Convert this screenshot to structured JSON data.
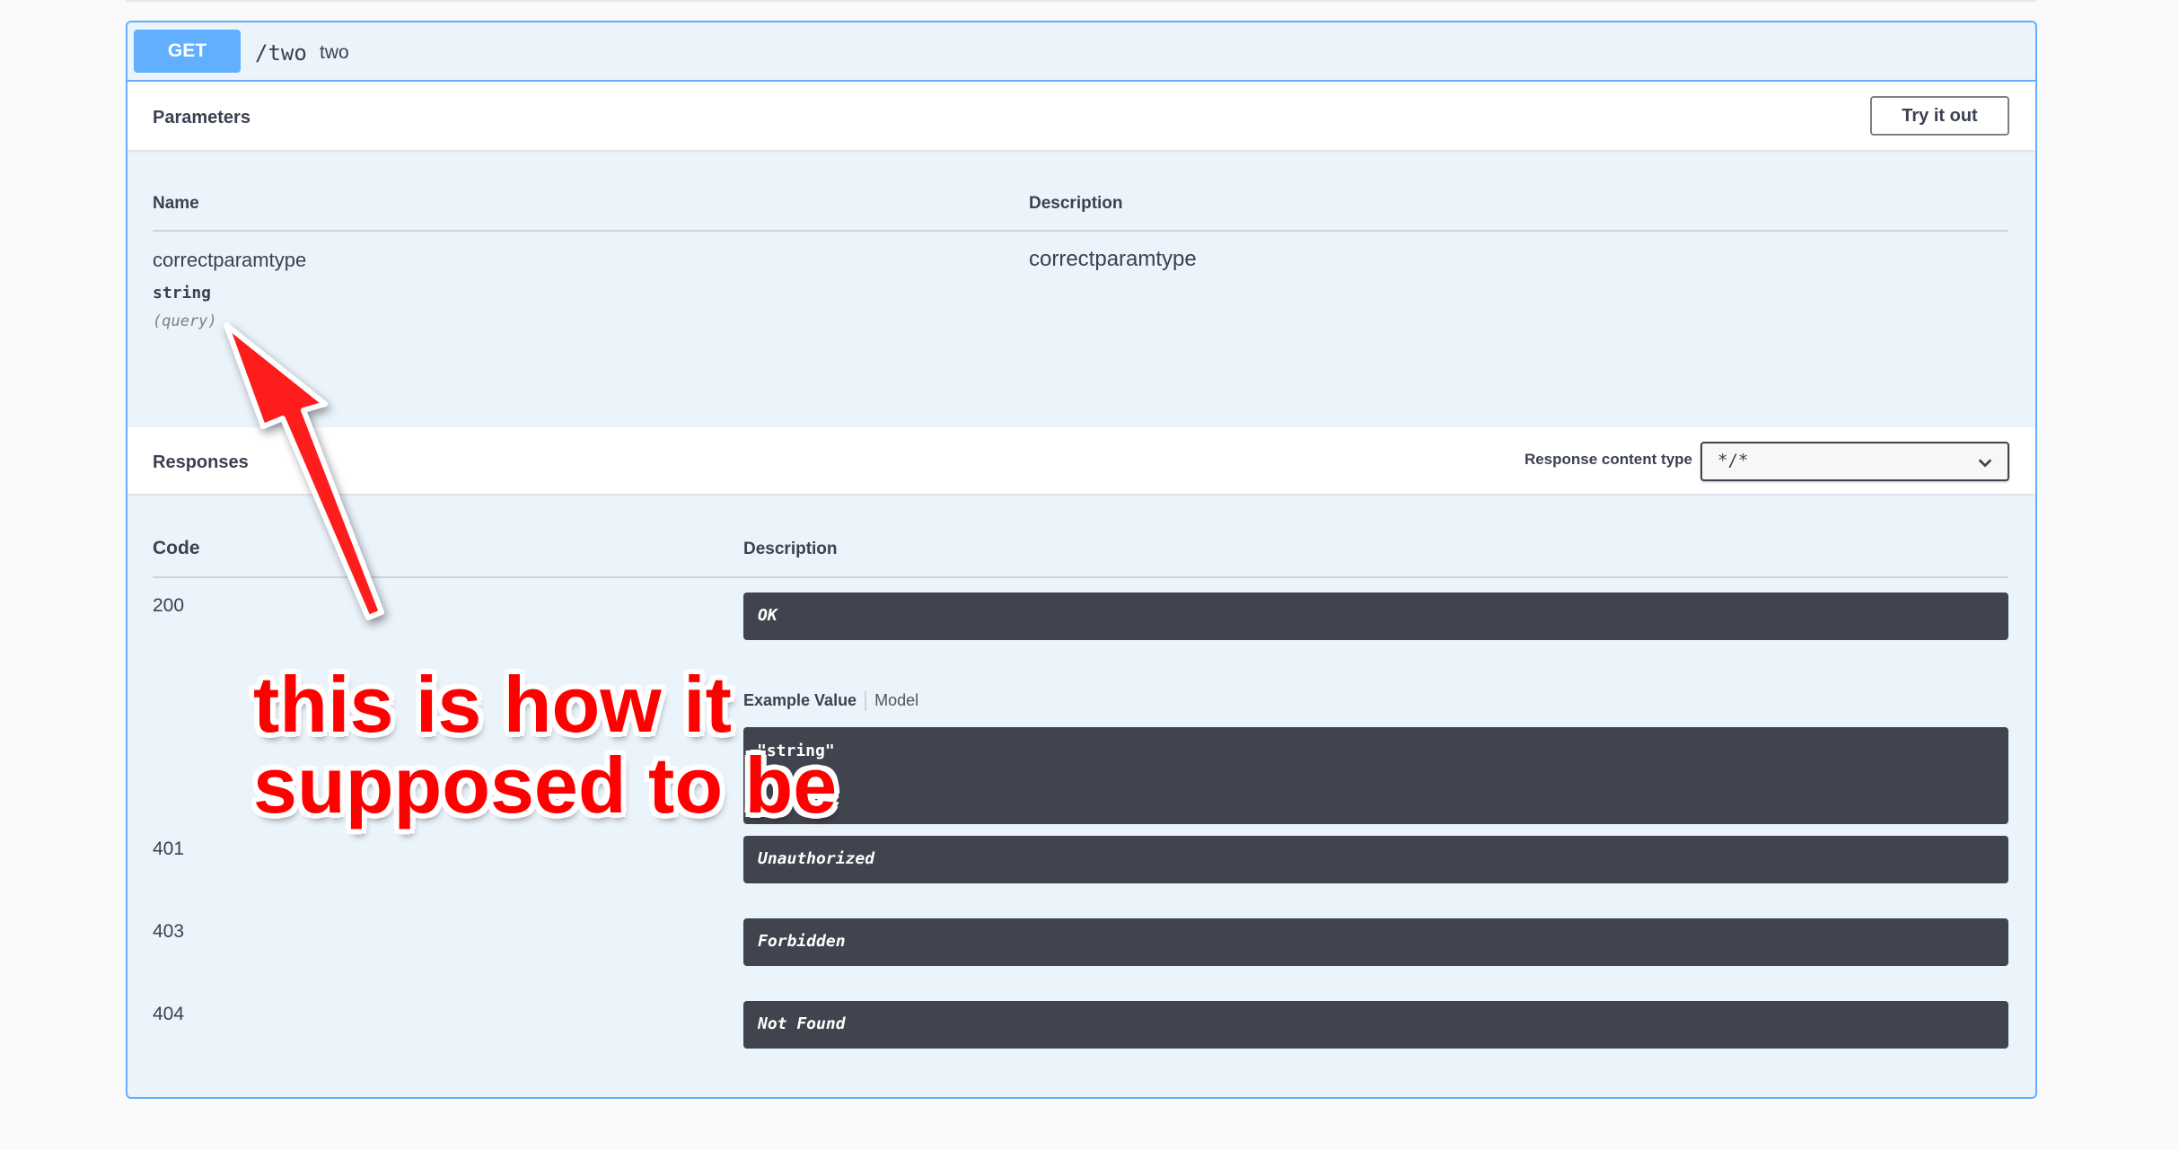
{
  "operation": {
    "method": "GET",
    "path": "/two",
    "summary": "two"
  },
  "parameters": {
    "title": "Parameters",
    "try_button": "Try it out",
    "col_name": "Name",
    "col_description": "Description",
    "rows": [
      {
        "name": "correctparamtype",
        "type": "string",
        "in": "(query)",
        "description": "correctparamtype"
      }
    ]
  },
  "responses": {
    "title": "Responses",
    "content_type_label": "Response content type",
    "content_type_value": "*/*",
    "col_code": "Code",
    "col_description": "Description",
    "example_tab": "Example Value",
    "model_tab": "Model",
    "example_value": "\"string\"",
    "rows": [
      {
        "code": "200",
        "description": "OK"
      },
      {
        "code": "401",
        "description": "Unauthorized"
      },
      {
        "code": "403",
        "description": "Forbidden"
      },
      {
        "code": "404",
        "description": "Not Found"
      }
    ]
  },
  "annotation": {
    "line1": "this is how it",
    "line2": "supposed to be",
    "color": "#ff0000"
  },
  "colors": {
    "get": "#61affe",
    "dark_box": "#41444e",
    "panel_bg": "#ebf3fb"
  },
  "icons": {
    "select_chevron": "chevron-down-icon",
    "arrow": "red-arrow-annotation"
  }
}
